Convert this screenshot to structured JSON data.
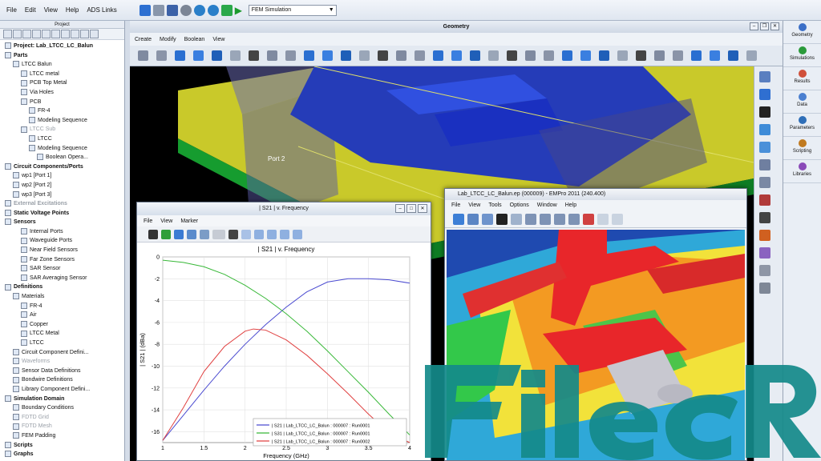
{
  "menu": [
    "File",
    "Edit",
    "View",
    "Help",
    "ADS Links"
  ],
  "toolbar": {
    "sim_combo": "FEM Simulation"
  },
  "project": {
    "header": "Project",
    "tree": [
      {
        "label": "Project: Lab_LTCC_LC_Balun",
        "lvl": 0,
        "bold": true
      },
      {
        "label": "Parts",
        "lvl": 0,
        "bold": true
      },
      {
        "label": "LTCC Balun",
        "lvl": 1
      },
      {
        "label": "LTCC metal",
        "lvl": 2
      },
      {
        "label": "PCB Top Metal",
        "lvl": 2
      },
      {
        "label": "Via Holes",
        "lvl": 2
      },
      {
        "label": "PCB",
        "lvl": 2
      },
      {
        "label": "FR-4",
        "lvl": 3
      },
      {
        "label": "Modeling Sequence",
        "lvl": 3
      },
      {
        "label": "LTCC Sub",
        "lvl": 2,
        "dim": true
      },
      {
        "label": "LTCC",
        "lvl": 3
      },
      {
        "label": "Modeling Sequence",
        "lvl": 3
      },
      {
        "label": "Boolean Opera...",
        "lvl": 4
      },
      {
        "label": "Circuit Components/Ports",
        "lvl": 0,
        "bold": true
      },
      {
        "label": "wp1 [Port 1]",
        "lvl": 1
      },
      {
        "label": "wp2 [Port 2]",
        "lvl": 1
      },
      {
        "label": "wp3 [Port 3]",
        "lvl": 1
      },
      {
        "label": "External Excitations",
        "lvl": 0,
        "bold": true,
        "dim": true
      },
      {
        "label": "Static Voltage Points",
        "lvl": 0,
        "bold": true
      },
      {
        "label": "Sensors",
        "lvl": 0,
        "bold": true
      },
      {
        "label": "Internal Ports",
        "lvl": 2
      },
      {
        "label": "Waveguide Ports",
        "lvl": 2
      },
      {
        "label": "Near Field Sensors",
        "lvl": 2
      },
      {
        "label": "Far Zone Sensors",
        "lvl": 2
      },
      {
        "label": "SAR Sensor",
        "lvl": 2
      },
      {
        "label": "SAR Averaging Sensor",
        "lvl": 2
      },
      {
        "label": "Definitions",
        "lvl": 0,
        "bold": true
      },
      {
        "label": "Materials",
        "lvl": 1
      },
      {
        "label": "FR-4",
        "lvl": 2
      },
      {
        "label": "Air",
        "lvl": 2
      },
      {
        "label": "Copper",
        "lvl": 2
      },
      {
        "label": "LTCC Metal",
        "lvl": 2
      },
      {
        "label": "LTCC",
        "lvl": 2
      },
      {
        "label": "Circuit Component Defini...",
        "lvl": 1
      },
      {
        "label": "Waveforms",
        "lvl": 1,
        "dim": true
      },
      {
        "label": "Sensor Data Definitions",
        "lvl": 1
      },
      {
        "label": "Bondwire Definitions",
        "lvl": 1
      },
      {
        "label": "Library Component Defini...",
        "lvl": 1
      },
      {
        "label": "Simulation Domain",
        "lvl": 0,
        "bold": true
      },
      {
        "label": "Boundary Conditions",
        "lvl": 1
      },
      {
        "label": "FDTD Grid",
        "lvl": 1,
        "dim": true
      },
      {
        "label": "FDTD Mesh",
        "lvl": 1,
        "dim": true
      },
      {
        "label": "FEM Padding",
        "lvl": 1
      },
      {
        "label": "Scripts",
        "lvl": 0,
        "bold": true
      },
      {
        "label": "Graphs",
        "lvl": 0,
        "bold": true
      }
    ]
  },
  "geometry": {
    "title": "Geometry",
    "menu": [
      "Create",
      "Modify",
      "Boolean",
      "View"
    ],
    "port_label": "Port 2"
  },
  "right_panel": [
    "Geometry",
    "Simulations",
    "Results",
    "Data",
    "Parameters",
    "Scripting",
    "Libraries"
  ],
  "plot_window": {
    "title": "| S21 | v. Frequency",
    "menu": [
      "File",
      "View",
      "Marker"
    ],
    "chart_title": "| S21 | v. Frequency",
    "xlabel": "Frequency (GHz)",
    "ylabel": "| S21 | (dBa)"
  },
  "chart_data": {
    "type": "line",
    "title": "| S21 | v. Frequency",
    "xlabel": "Frequency (GHz)",
    "ylabel": "| S21 | (dBa)",
    "xlim": [
      1,
      4
    ],
    "ylim": [
      -17,
      0
    ],
    "xticks": [
      1,
      1.5,
      2,
      2.5,
      3,
      3.5,
      4
    ],
    "yticks": [
      0,
      -2,
      -4,
      -6,
      -8,
      -10,
      -12,
      -14,
      -16
    ],
    "series": [
      {
        "name": "| S21 | Lab_LTCC_LC_Balun : 000007 : Run0001",
        "color": "#4a4ad0",
        "x": [
          1,
          1.25,
          1.5,
          1.75,
          2,
          2.25,
          2.5,
          2.75,
          3,
          3.25,
          3.5,
          3.75,
          4
        ],
        "y": [
          -16.8,
          -14.5,
          -12.2,
          -10,
          -8,
          -6.2,
          -4.6,
          -3.2,
          -2.3,
          -2,
          -2,
          -2.1,
          -2.4
        ]
      },
      {
        "name": "| S31 | Lab_LTCC_LC_Balun : 000007 : Run0001",
        "color": "#38b838",
        "x": [
          1,
          1.25,
          1.5,
          1.75,
          2,
          2.25,
          2.5,
          2.75,
          3,
          3.25,
          3.5,
          3.75,
          4
        ],
        "y": [
          -0.3,
          -0.5,
          -0.9,
          -1.6,
          -2.6,
          -3.8,
          -5.2,
          -6.8,
          -8.6,
          -10.5,
          -12.4,
          -14.4,
          -16.3
        ]
      },
      {
        "name": "| S21 | Lab_LTCC_LC_Balun : 000007 : Run0002",
        "color": "#e04040",
        "x": [
          1,
          1.25,
          1.5,
          1.75,
          2,
          2.1,
          2.25,
          2.5,
          2.75,
          3,
          3.25,
          3.5,
          3.75,
          4
        ],
        "y": [
          -16.8,
          -13.8,
          -10.5,
          -8.2,
          -6.8,
          -6.6,
          -6.7,
          -7.6,
          -9,
          -10.7,
          -12.5,
          -14.4,
          -16.1,
          -17.6
        ]
      }
    ],
    "legend": "bottom-right"
  },
  "empro": {
    "title": "Lab_LTCC_LC_Balun.ep (000009) - EMPro 2011 (240.400)",
    "menu": [
      "File",
      "View",
      "Tools",
      "Options",
      "Window",
      "Help"
    ]
  },
  "watermark": "FileCR"
}
